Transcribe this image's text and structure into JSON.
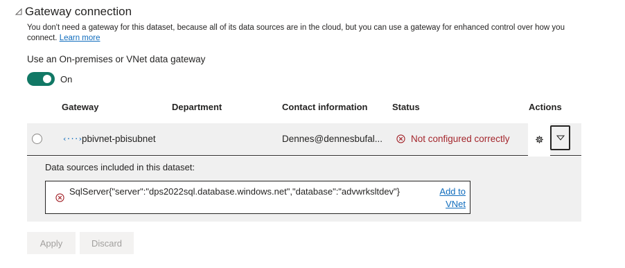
{
  "section": {
    "title": "Gateway connection",
    "description": "You don't need a gateway for this dataset, because all of its data sources are in the cloud, but you can use a gateway for enhanced control over how you connect.",
    "learn_more": "Learn more"
  },
  "gateway_toggle": {
    "label": "Use an On-premises or VNet data gateway",
    "state": "On"
  },
  "table": {
    "headers": {
      "gateway": "Gateway",
      "department": "Department",
      "contact": "Contact information",
      "status": "Status",
      "actions": "Actions"
    },
    "row": {
      "icon": "‹···›",
      "gateway": "pbivnet-pbisubnet",
      "department": "",
      "contact": "Dennes@dennesbufal...",
      "status": "Not configured correctly"
    }
  },
  "detail": {
    "label": "Data sources included in this dataset:",
    "data_source": "SqlServer{\"server\":\"dps2022sql.database.windows.net\",\"database\":\"advwrksltdev\"}",
    "link": "Add to VNet"
  },
  "buttons": {
    "apply": "Apply",
    "discard": "Discard"
  },
  "colors": {
    "toggle_on": "#117865",
    "link": "#0f6cbd",
    "error": "#a4262c",
    "row_bg": "#f0f0f0"
  }
}
